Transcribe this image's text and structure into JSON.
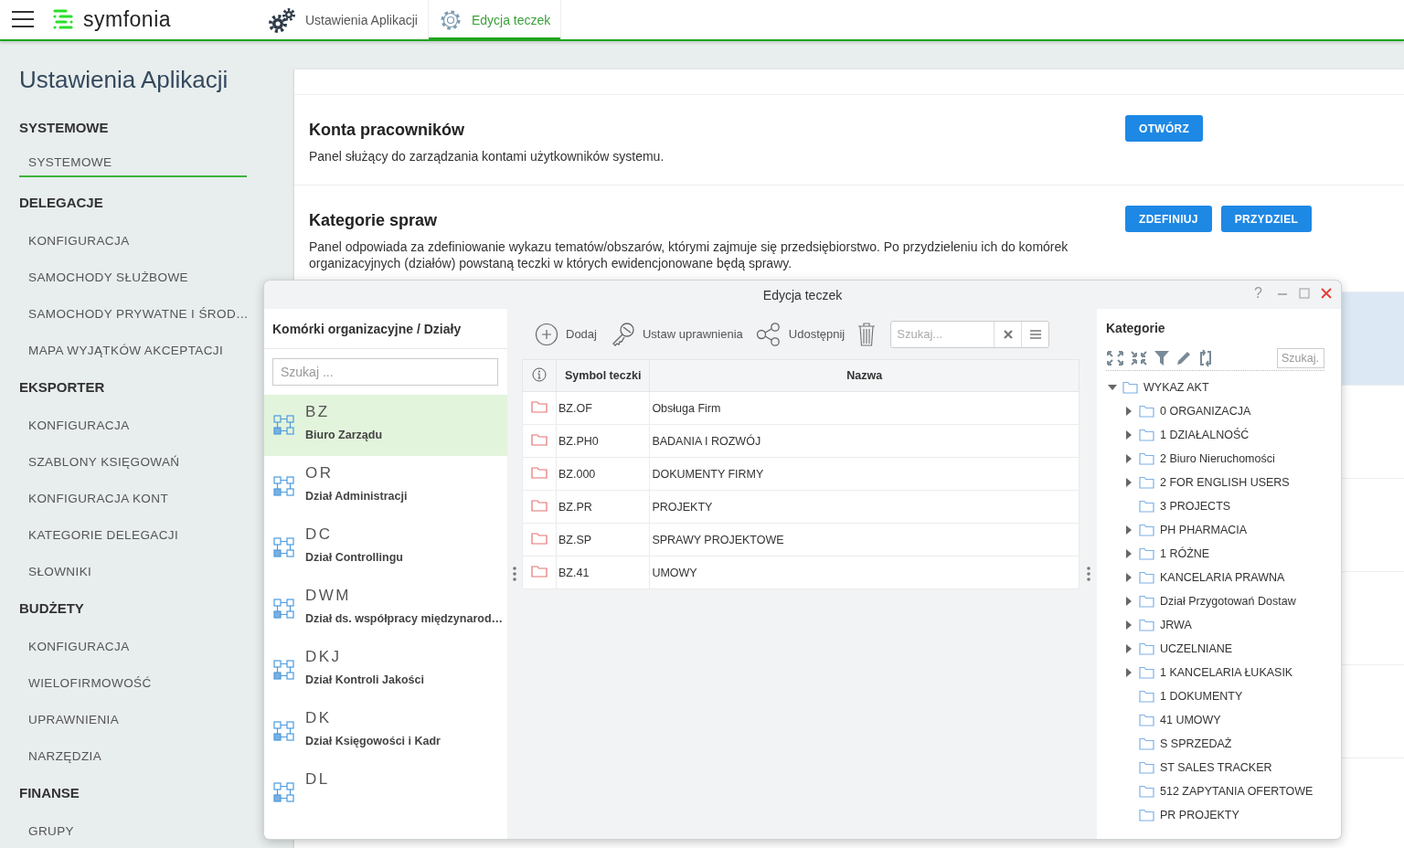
{
  "header": {
    "logo": "symfonia",
    "tabs": [
      {
        "label": "Ustawienia Aplikacji",
        "selected": false
      },
      {
        "label": "Edycja teczek",
        "selected": true
      }
    ]
  },
  "sidebar": {
    "title": "Ustawienia Aplikacji",
    "groups": [
      {
        "label": "SYSTEMOWE",
        "items": [
          {
            "label": "SYSTEMOWE",
            "selected": true
          }
        ]
      },
      {
        "label": "DELEGACJE",
        "items": [
          {
            "label": "KONFIGURACJA",
            "selected": false
          },
          {
            "label": "SAMOCHODY SŁUŻBOWE",
            "selected": false
          },
          {
            "label": "SAMOCHODY PRYWATNE I ŚROD…",
            "selected": false
          },
          {
            "label": "MAPA WYJĄTKÓW AKCEPTACJI",
            "selected": false
          }
        ]
      },
      {
        "label": "EKSPORTER",
        "items": [
          {
            "label": "KONFIGURACJA",
            "selected": false
          },
          {
            "label": "SZABLONY KSIĘGOWAŃ",
            "selected": false
          },
          {
            "label": "KONFIGURACJA KONT",
            "selected": false
          },
          {
            "label": "KATEGORIE DELEGACJI",
            "selected": false
          },
          {
            "label": "SŁOWNIKI",
            "selected": false
          }
        ]
      },
      {
        "label": "BUDŻETY",
        "items": [
          {
            "label": "KONFIGURACJA",
            "selected": false
          },
          {
            "label": "WIELOFIRMOWOŚĆ",
            "selected": false
          },
          {
            "label": "UPRAWNIENIA",
            "selected": false
          },
          {
            "label": "NARZĘDZIA",
            "selected": false
          }
        ]
      },
      {
        "label": "FINANSE",
        "items": [
          {
            "label": "GRUPY",
            "selected": false
          }
        ]
      }
    ]
  },
  "content": {
    "cards": [
      {
        "title": "Konta pracowników",
        "description": "Panel służący do zarządzania kontami użytkowników systemu.",
        "buttons": [
          "OTWÓRZ"
        ]
      },
      {
        "title": "Kategorie spraw",
        "description": "Panel odpowiada za zdefiniowanie wykazu tematów/obszarów, którymi zajmuje się przedsiębiorstwo. Po przydzieleniu ich do komórek organizacyjnych (działów) powstaną teczki w których ewidencjonowane będą sprawy.",
        "buttons": [
          "ZDEFINIUJ",
          "PRZYDZIEL"
        ]
      }
    ]
  },
  "dialog": {
    "title": "Edycja teczek",
    "help": "?",
    "units": {
      "title": "Komórki organizacyjne / Działy",
      "search_placeholder": "Szukaj ...",
      "items": [
        {
          "code": "BZ",
          "name": "Biuro Zarządu",
          "selected": true
        },
        {
          "code": "OR",
          "name": "Dział Administracji",
          "selected": false
        },
        {
          "code": "DC",
          "name": "Dział Controllingu",
          "selected": false
        },
        {
          "code": "DWM",
          "name": "Dział ds. współpracy międzynarod…",
          "selected": false
        },
        {
          "code": "DKJ",
          "name": "Dział Kontroli Jakości",
          "selected": false
        },
        {
          "code": "DK",
          "name": "Dział Księgowości i Kadr",
          "selected": false
        },
        {
          "code": "DL",
          "selected": false
        }
      ]
    },
    "folders": {
      "actions": [
        {
          "kind": "add",
          "label": "Dodaj"
        },
        {
          "kind": "permissions",
          "label": "Ustaw uprawnienia"
        },
        {
          "kind": "share",
          "label": "Udostępnij"
        },
        {
          "kind": "delete"
        }
      ],
      "search_placeholder": "Szukaj...",
      "columns": [
        "Symbol teczki",
        "Nazwa"
      ],
      "rows": [
        {
          "symbol": "BZ.OF",
          "name": "Obsługa Firm"
        },
        {
          "symbol": "BZ.PH0",
          "name": "BADANIA I ROZWÓJ"
        },
        {
          "symbol": "BZ.000",
          "name": "DOKUMENTY FIRMY"
        },
        {
          "symbol": "BZ.PR",
          "name": "PROJEKTY"
        },
        {
          "symbol": "BZ.SP",
          "name": "SPRAWY PROJEKTOWE"
        },
        {
          "symbol": "BZ.41",
          "name": "UMOWY"
        }
      ]
    },
    "categories": {
      "title": "Kategorie",
      "search_placeholder": "Szukaj..",
      "tree": [
        {
          "label": "WYKAZ AKT",
          "expandable": true,
          "expanded": true,
          "children": [
            {
              "label": "0 ORGANIZACJA",
              "expandable": true
            },
            {
              "label": "1 DZIAŁALNOŚĆ",
              "expandable": true
            },
            {
              "label": "2 Biuro Nieruchomości",
              "expandable": true
            },
            {
              "label": "2 FOR ENGLISH USERS",
              "expandable": true
            },
            {
              "label": "3 PROJECTS",
              "expandable": false
            },
            {
              "label": "PH PHARMACIA",
              "expandable": true
            },
            {
              "label": "1 RÓŻNE",
              "expandable": true
            },
            {
              "label": "KANCELARIA PRAWNA",
              "expandable": true
            },
            {
              "label": "Dział Przygotowań Dostaw",
              "expandable": true
            },
            {
              "label": "JRWA",
              "expandable": true
            },
            {
              "label": "UCZELNIANE",
              "expandable": true
            },
            {
              "label": "1 KANCELARIA ŁUKASIK",
              "expandable": true
            },
            {
              "label": "1 DOKUMENTY",
              "expandable": false
            },
            {
              "label": "41 UMOWY",
              "expandable": false
            },
            {
              "label": "S SPRZEDAŻ",
              "expandable": false
            },
            {
              "label": "ST SALES TRACKER",
              "expandable": false
            },
            {
              "label": "512 ZAPYTANIA OFERTOWE",
              "expandable": false
            },
            {
              "label": "PR PROJEKTY",
              "expandable": false
            }
          ]
        }
      ]
    }
  }
}
